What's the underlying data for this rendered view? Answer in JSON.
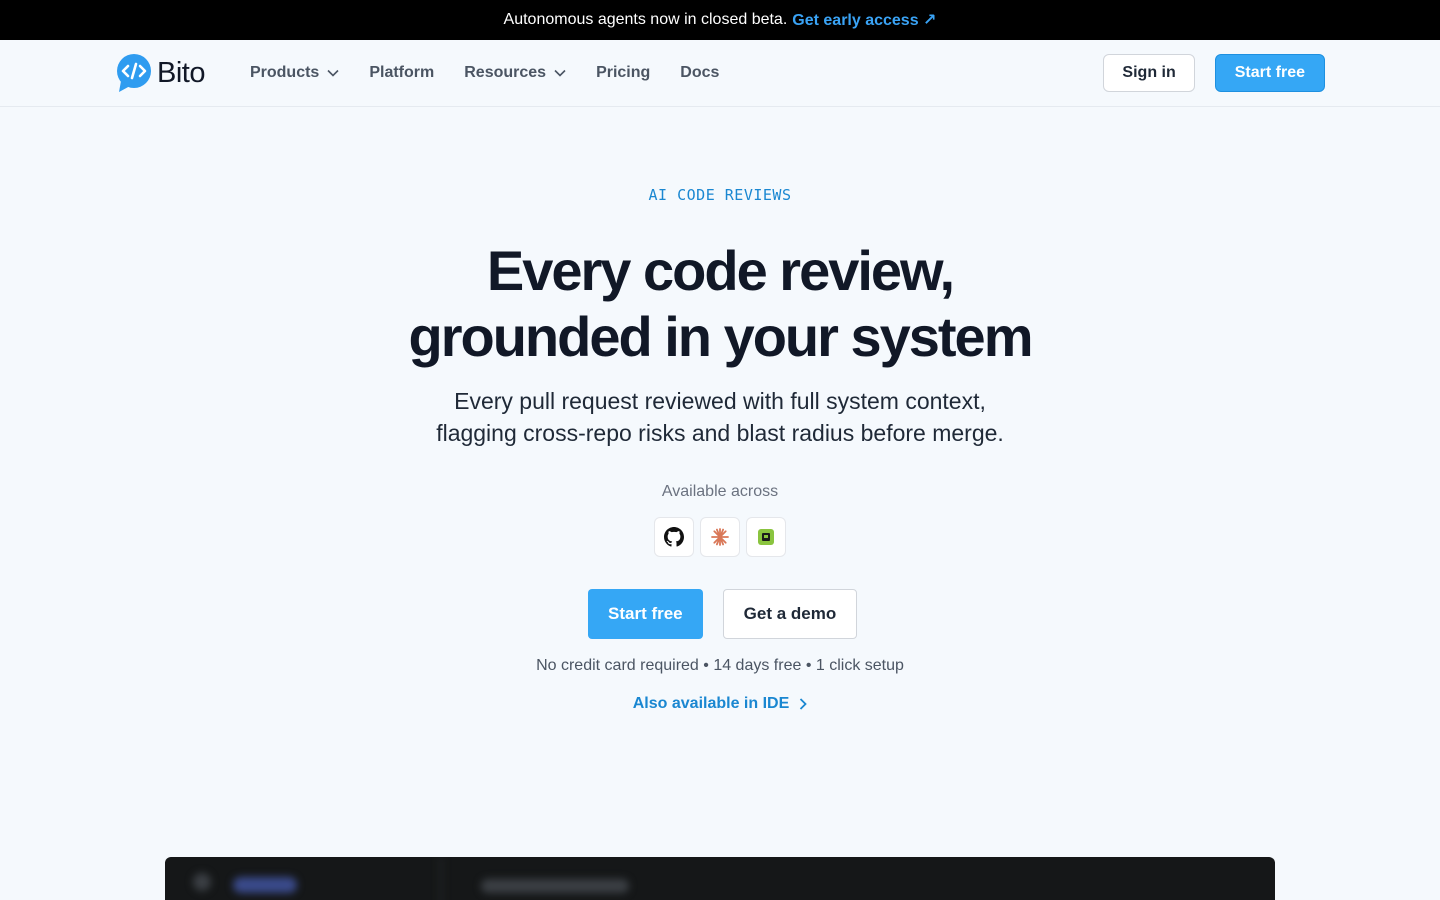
{
  "announcement": {
    "text": "Autonomous agents now in closed beta.",
    "link": "Get early access ↗"
  },
  "nav": {
    "brand": "Bito",
    "items": [
      {
        "label": "Products",
        "dropdown": true
      },
      {
        "label": "Platform",
        "dropdown": false
      },
      {
        "label": "Resources",
        "dropdown": true
      },
      {
        "label": "Pricing",
        "dropdown": false
      },
      {
        "label": "Docs",
        "dropdown": false
      }
    ],
    "sign_in": "Sign in",
    "start_free": "Start free"
  },
  "hero": {
    "eyebrow": "AI CODE REVIEWS",
    "headline_line1": "Every code review,",
    "headline_line2": "grounded in your system",
    "sub_line1": "Every pull request reviewed with full system context,",
    "sub_line2": "flagging cross-repo risks and blast radius before merge.",
    "available_label": "Available across",
    "integrations": [
      "github-icon",
      "claude-icon",
      "gitlab-bucket-icon"
    ],
    "cta_primary": "Start free",
    "cta_secondary": "Get a demo",
    "fineprint": "No credit card required • 14 days free • 1 click setup",
    "ide_link": "Also available in IDE"
  },
  "colors": {
    "accent": "#35a7f5",
    "link": "#1a87d1",
    "background": "#f5f9fd"
  }
}
